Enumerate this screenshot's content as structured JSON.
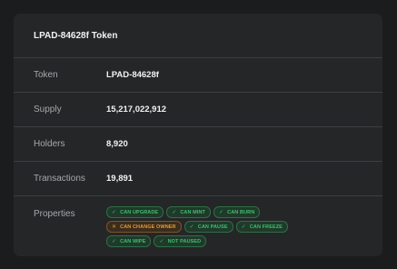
{
  "card": {
    "title": "LPAD-84628f Token"
  },
  "rows": [
    {
      "label": "Token",
      "value": "LPAD-84628f"
    },
    {
      "label": "Supply",
      "value": "15,217,022,912"
    },
    {
      "label": "Holders",
      "value": "8,920"
    },
    {
      "label": "Transactions",
      "value": "19,891"
    }
  ],
  "properties": {
    "label": "Properties",
    "badges": [
      {
        "text": "CAN UPGRADE",
        "status": "ok",
        "icon": "check-icon",
        "glyph": "✓"
      },
      {
        "text": "CAN MINT",
        "status": "ok",
        "icon": "check-icon",
        "glyph": "✓"
      },
      {
        "text": "CAN BURN",
        "status": "ok",
        "icon": "check-icon",
        "glyph": "✓"
      },
      {
        "text": "CAN CHANGE OWNER",
        "status": "warn",
        "icon": "cross-icon",
        "glyph": "✕"
      },
      {
        "text": "CAN PAUSE",
        "status": "ok",
        "icon": "check-icon",
        "glyph": "✓"
      },
      {
        "text": "CAN FREEZE",
        "status": "ok",
        "icon": "check-icon",
        "glyph": "✓"
      },
      {
        "text": "CAN WIPE",
        "status": "ok",
        "icon": "check-icon",
        "glyph": "✓"
      },
      {
        "text": "NOT PAUSED",
        "status": "ok",
        "icon": "check-icon",
        "glyph": "✓"
      }
    ]
  },
  "colors": {
    "ok": "#3fbf6e",
    "warn": "#e39a3b"
  }
}
